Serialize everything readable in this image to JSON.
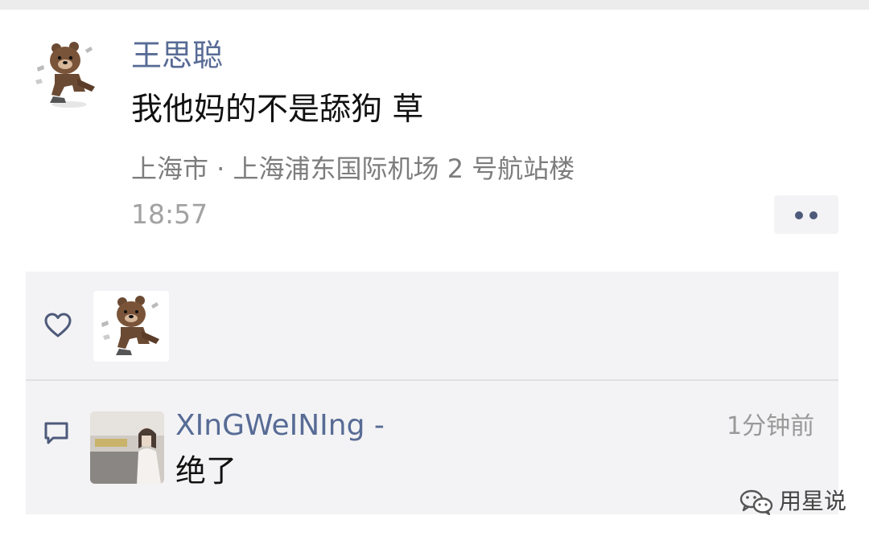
{
  "post": {
    "author": "王思聪",
    "text": "我他妈的不是舔狗 草",
    "location": "上海市 · 上海浦东国际机场 2 号航站楼",
    "time": "18:57",
    "avatar_icon": "brown-bear-sticker",
    "more_icon": "two-dots-icon"
  },
  "likes": {
    "icon": "heart-outline-icon",
    "users": [
      {
        "avatar_icon": "brown-bear-sticker"
      }
    ]
  },
  "comments": [
    {
      "icon": "speech-bubble-icon",
      "name": "XInGWeINIng -",
      "time": "1分钟前",
      "text": "绝了",
      "avatar_icon": "photo-avatar"
    }
  ],
  "watermark": {
    "text": "用星说",
    "icon": "wechat-logo-icon"
  },
  "colors": {
    "name_link": "#576b95",
    "panel_bg": "#f3f3f5",
    "secondary_text": "#7d7d7d",
    "time_text": "#a2a2a2"
  }
}
